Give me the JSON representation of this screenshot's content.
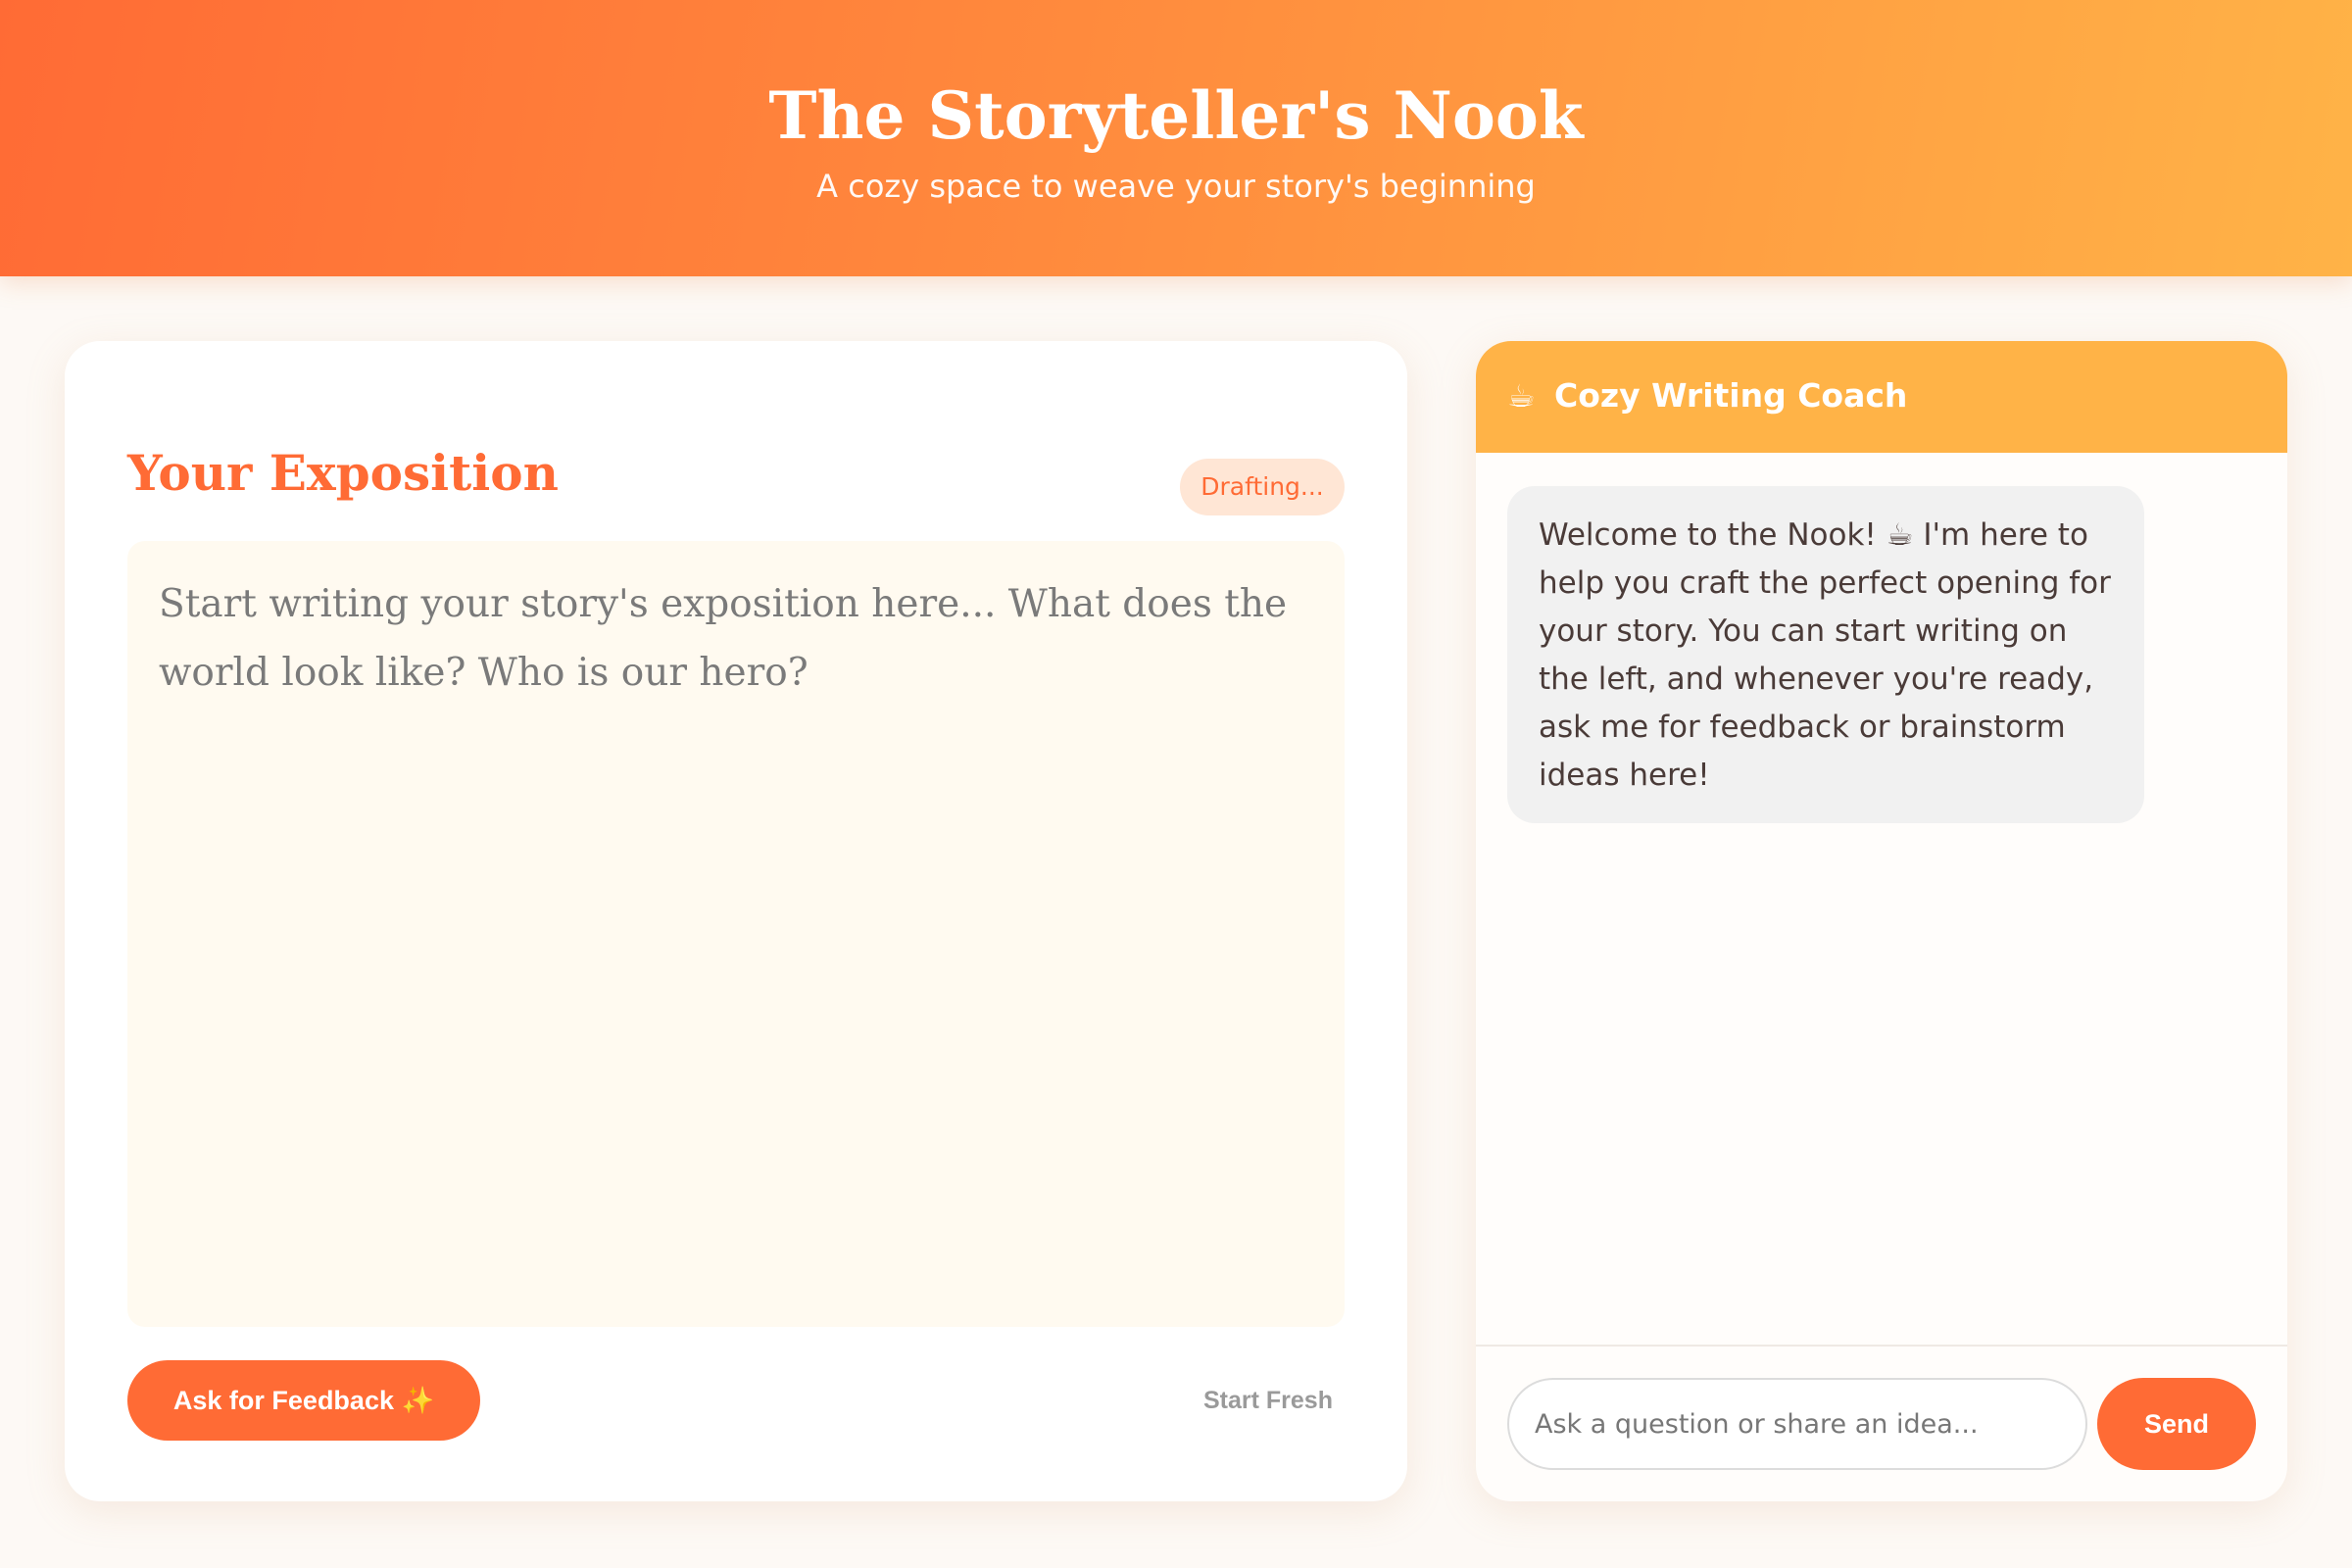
{
  "header": {
    "title": "The Storyteller's Nook",
    "subtitle": "A cozy space to weave your story's beginning"
  },
  "editor": {
    "title": "Your Exposition",
    "status": "Drafting...",
    "placeholder": "Start writing your story's exposition here... What does the world look like? Who is our hero?",
    "value": "",
    "feedback_button": "Ask for Feedback ✨",
    "reset_button": "Start Fresh"
  },
  "chat": {
    "icon": "coffee-icon",
    "icon_glyph": "☕",
    "title": "Cozy Writing Coach",
    "messages": [
      {
        "role": "coach",
        "text": "Welcome to the Nook! ☕ I'm here to help you craft the perfect opening for your story. You can start writing on the left, and whenever you're ready, ask me for feedback or brainstorm ideas here!"
      }
    ],
    "input_placeholder": "Ask a question or share an idea...",
    "input_value": "",
    "send_button": "Send"
  },
  "colors": {
    "accent": "#ff6b35",
    "header_gradient_start": "#ff6b35",
    "header_gradient_end": "#ffb347",
    "chat_header": "#ffb347",
    "badge_background": "#ffe6d5",
    "editor_background": "#fffaf0",
    "page_background": "#fdf9f5"
  }
}
